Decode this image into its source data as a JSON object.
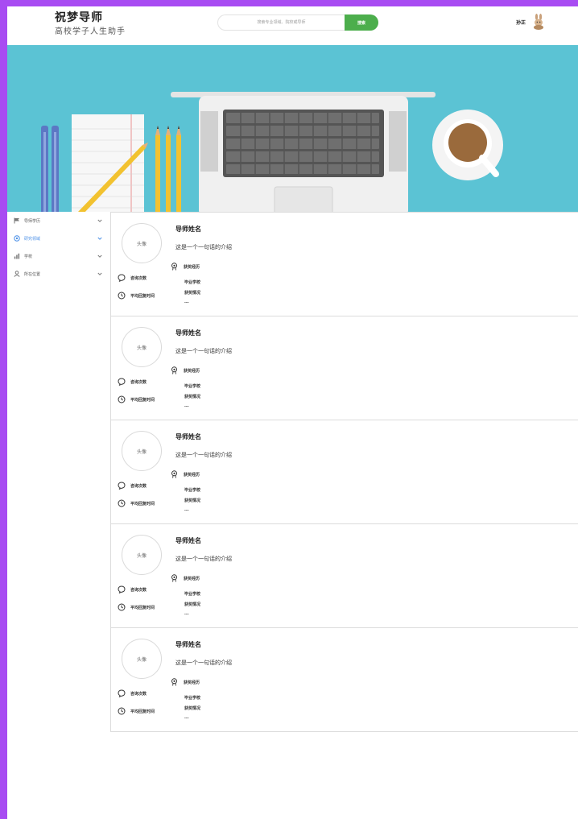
{
  "header": {
    "brand_title": "祝梦导师",
    "brand_subtitle": "高校学子人生助手",
    "search_placeholder": "搜索专业领域、院校或导师",
    "search_button": "搜索",
    "user_name": "孙正"
  },
  "sidebar": {
    "items": [
      {
        "label": "导师学历",
        "icon": "flag-icon",
        "active": false
      },
      {
        "label": "研究领域",
        "icon": "target-icon",
        "active": true
      },
      {
        "label": "学校",
        "icon": "chart-icon",
        "active": false
      },
      {
        "label": "所在位置",
        "icon": "person-icon",
        "active": false
      }
    ]
  },
  "cards": [
    {
      "avatar": "头像",
      "name": "导师姓名",
      "intro": "这是一个一句话的介绍",
      "consult_label": "咨询次数",
      "response_label": "平均回复时间",
      "history_label": "获奖经历",
      "line1": "毕业学校",
      "line2": "获奖情况",
      "more": "..."
    },
    {
      "avatar": "头像",
      "name": "导师姓名",
      "intro": "这是一个一句话的介绍",
      "consult_label": "咨询次数",
      "response_label": "平均回复时间",
      "history_label": "获奖经历",
      "line1": "毕业学校",
      "line2": "获奖情况",
      "more": "..."
    },
    {
      "avatar": "头像",
      "name": "导师姓名",
      "intro": "这是一个一句话的介绍",
      "consult_label": "咨询次数",
      "response_label": "平均回复时间",
      "history_label": "获奖经历",
      "line1": "毕业学校",
      "line2": "获奖情况",
      "more": "..."
    },
    {
      "avatar": "头像",
      "name": "导师姓名",
      "intro": "这是一个一句话的介绍",
      "consult_label": "咨询次数",
      "response_label": "平均回复时间",
      "history_label": "获奖经历",
      "line1": "毕业学校",
      "line2": "获奖情况",
      "more": "..."
    },
    {
      "avatar": "头像",
      "name": "导师姓名",
      "intro": "这是一个一句话的介绍",
      "consult_label": "咨询次数",
      "response_label": "平均回复时间",
      "history_label": "获奖经历",
      "line1": "毕业学校",
      "line2": "获奖情况",
      "more": "..."
    }
  ],
  "colors": {
    "frame": "#a84cf2",
    "banner": "#5bc3d4",
    "search_button": "#4cae4c",
    "sidebar_active": "#4a8fe7"
  }
}
